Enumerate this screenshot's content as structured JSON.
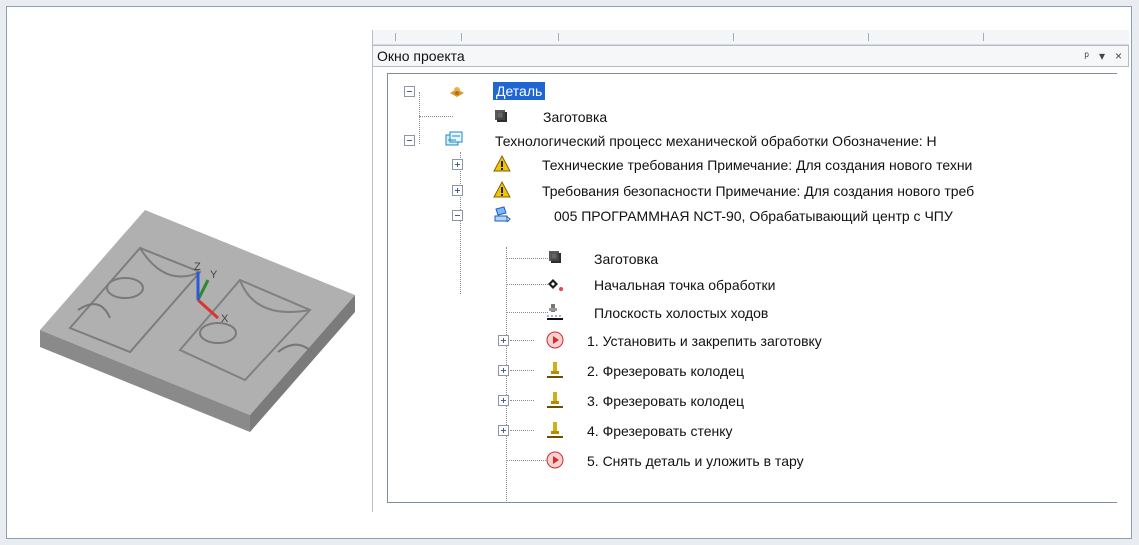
{
  "project_window": {
    "title": "Окно проекта",
    "pin_label": "ᵖ",
    "menu_label": "▾",
    "close_label": "×"
  },
  "tree": {
    "part": "Деталь",
    "blank": "Заготовка",
    "process": "Технологический процесс механической обработки  Обозначение:      Н",
    "tech_req": "Технические требования  Примечание: Для создания нового техни",
    "safety_req": "Требования безопасности  Примечание: Для создания нового треб",
    "operation": "005  ПРОГРАММНАЯ NCT-90, Обрабатывающий центр с ЧПУ",
    "op_blank": "Заготовка",
    "start_point": "Начальная точка обработки",
    "idle_plane": "Плоскость холостых ходов",
    "step1": "1.  Установить и закрепить заготовку",
    "step2": "2.  Фрезеровать колодец",
    "step3": "3.  Фрезеровать колодец",
    "step4": "4.  Фрезеровать стенку",
    "step5": "5.  Снять деталь и уложить в тару"
  },
  "model": {
    "axis_labels": [
      "X",
      "Y",
      "Z"
    ]
  },
  "colors": {
    "accent": "#1f66d2",
    "model_top": "#a9a9a9",
    "model_side": "#8f8f8f"
  }
}
